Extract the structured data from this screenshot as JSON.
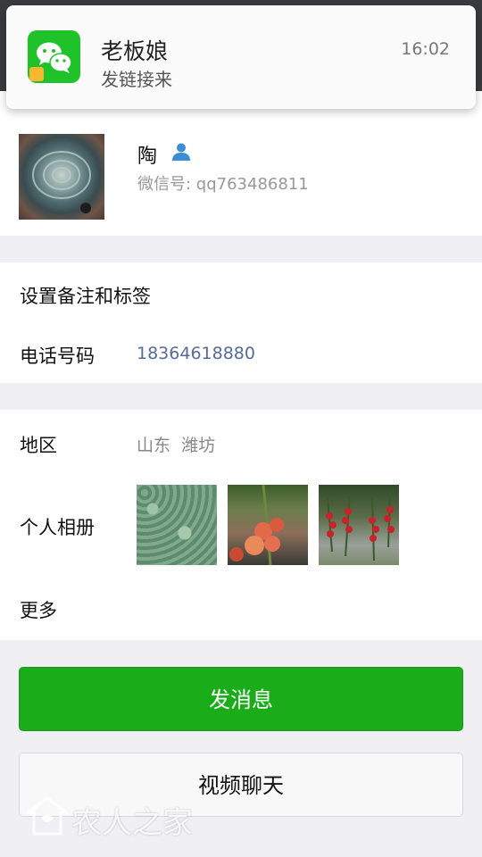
{
  "notification": {
    "sender": "老板娘",
    "message": "发链接来",
    "time": "16:02",
    "app_icon": "wechat-icon",
    "colors": {
      "app_green": "#20c22a"
    }
  },
  "profile": {
    "name": "陶",
    "wechat_id": "微信号: qq763486811",
    "avatar_icon": "succulent-photo",
    "person_icon": "person-icon"
  },
  "rows": {
    "remark_label": "设置备注和标签",
    "phone_label": "电话号码",
    "phone_value": "18364618880",
    "region_label": "地区",
    "region_value": "山东  潍坊",
    "album_label": "个人相册",
    "more_label": "更多"
  },
  "album_photos": [
    "succulent-field-photo",
    "tomato-plant-photo",
    "cherry-tomato-photo"
  ],
  "buttons": {
    "send_message": "发消息",
    "video_chat": "视频聊天"
  },
  "watermark": {
    "text": "农人之家"
  },
  "colors": {
    "header_dark": "#393a3f",
    "primary_green": "#1aad19",
    "link_blue": "#576b95",
    "background": "#efeff4"
  }
}
